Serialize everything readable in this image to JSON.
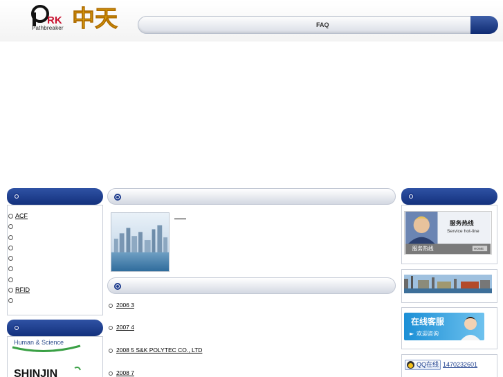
{
  "header": {
    "logo_text": "Pathbreaker",
    "nav_faq": "FAQ"
  },
  "categories": [
    "ACF",
    "",
    "",
    "",
    "",
    "",
    "",
    "RFID",
    ""
  ],
  "partners": {
    "partner1_text": "Human & Science",
    "partner2_text": "SHINJIN"
  },
  "news": [
    "2006 3",
    "2007 4",
    "2008 5    S&K POLYTEC CO., LTD",
    "2008 7"
  ],
  "service": {
    "hotline_title": "服务热线",
    "hotline_en": "Service hot-line",
    "hotline_caption": "服务热线",
    "home_label": "HOME",
    "kefu_title": "在线客服",
    "kefu_sub": "欢迎咨询",
    "qq_label": "QQ在线",
    "qq_number": "1470232601"
  },
  "colors": {
    "bar_dark": "#1c3a8c",
    "link_blue": "#1b3d8c"
  }
}
